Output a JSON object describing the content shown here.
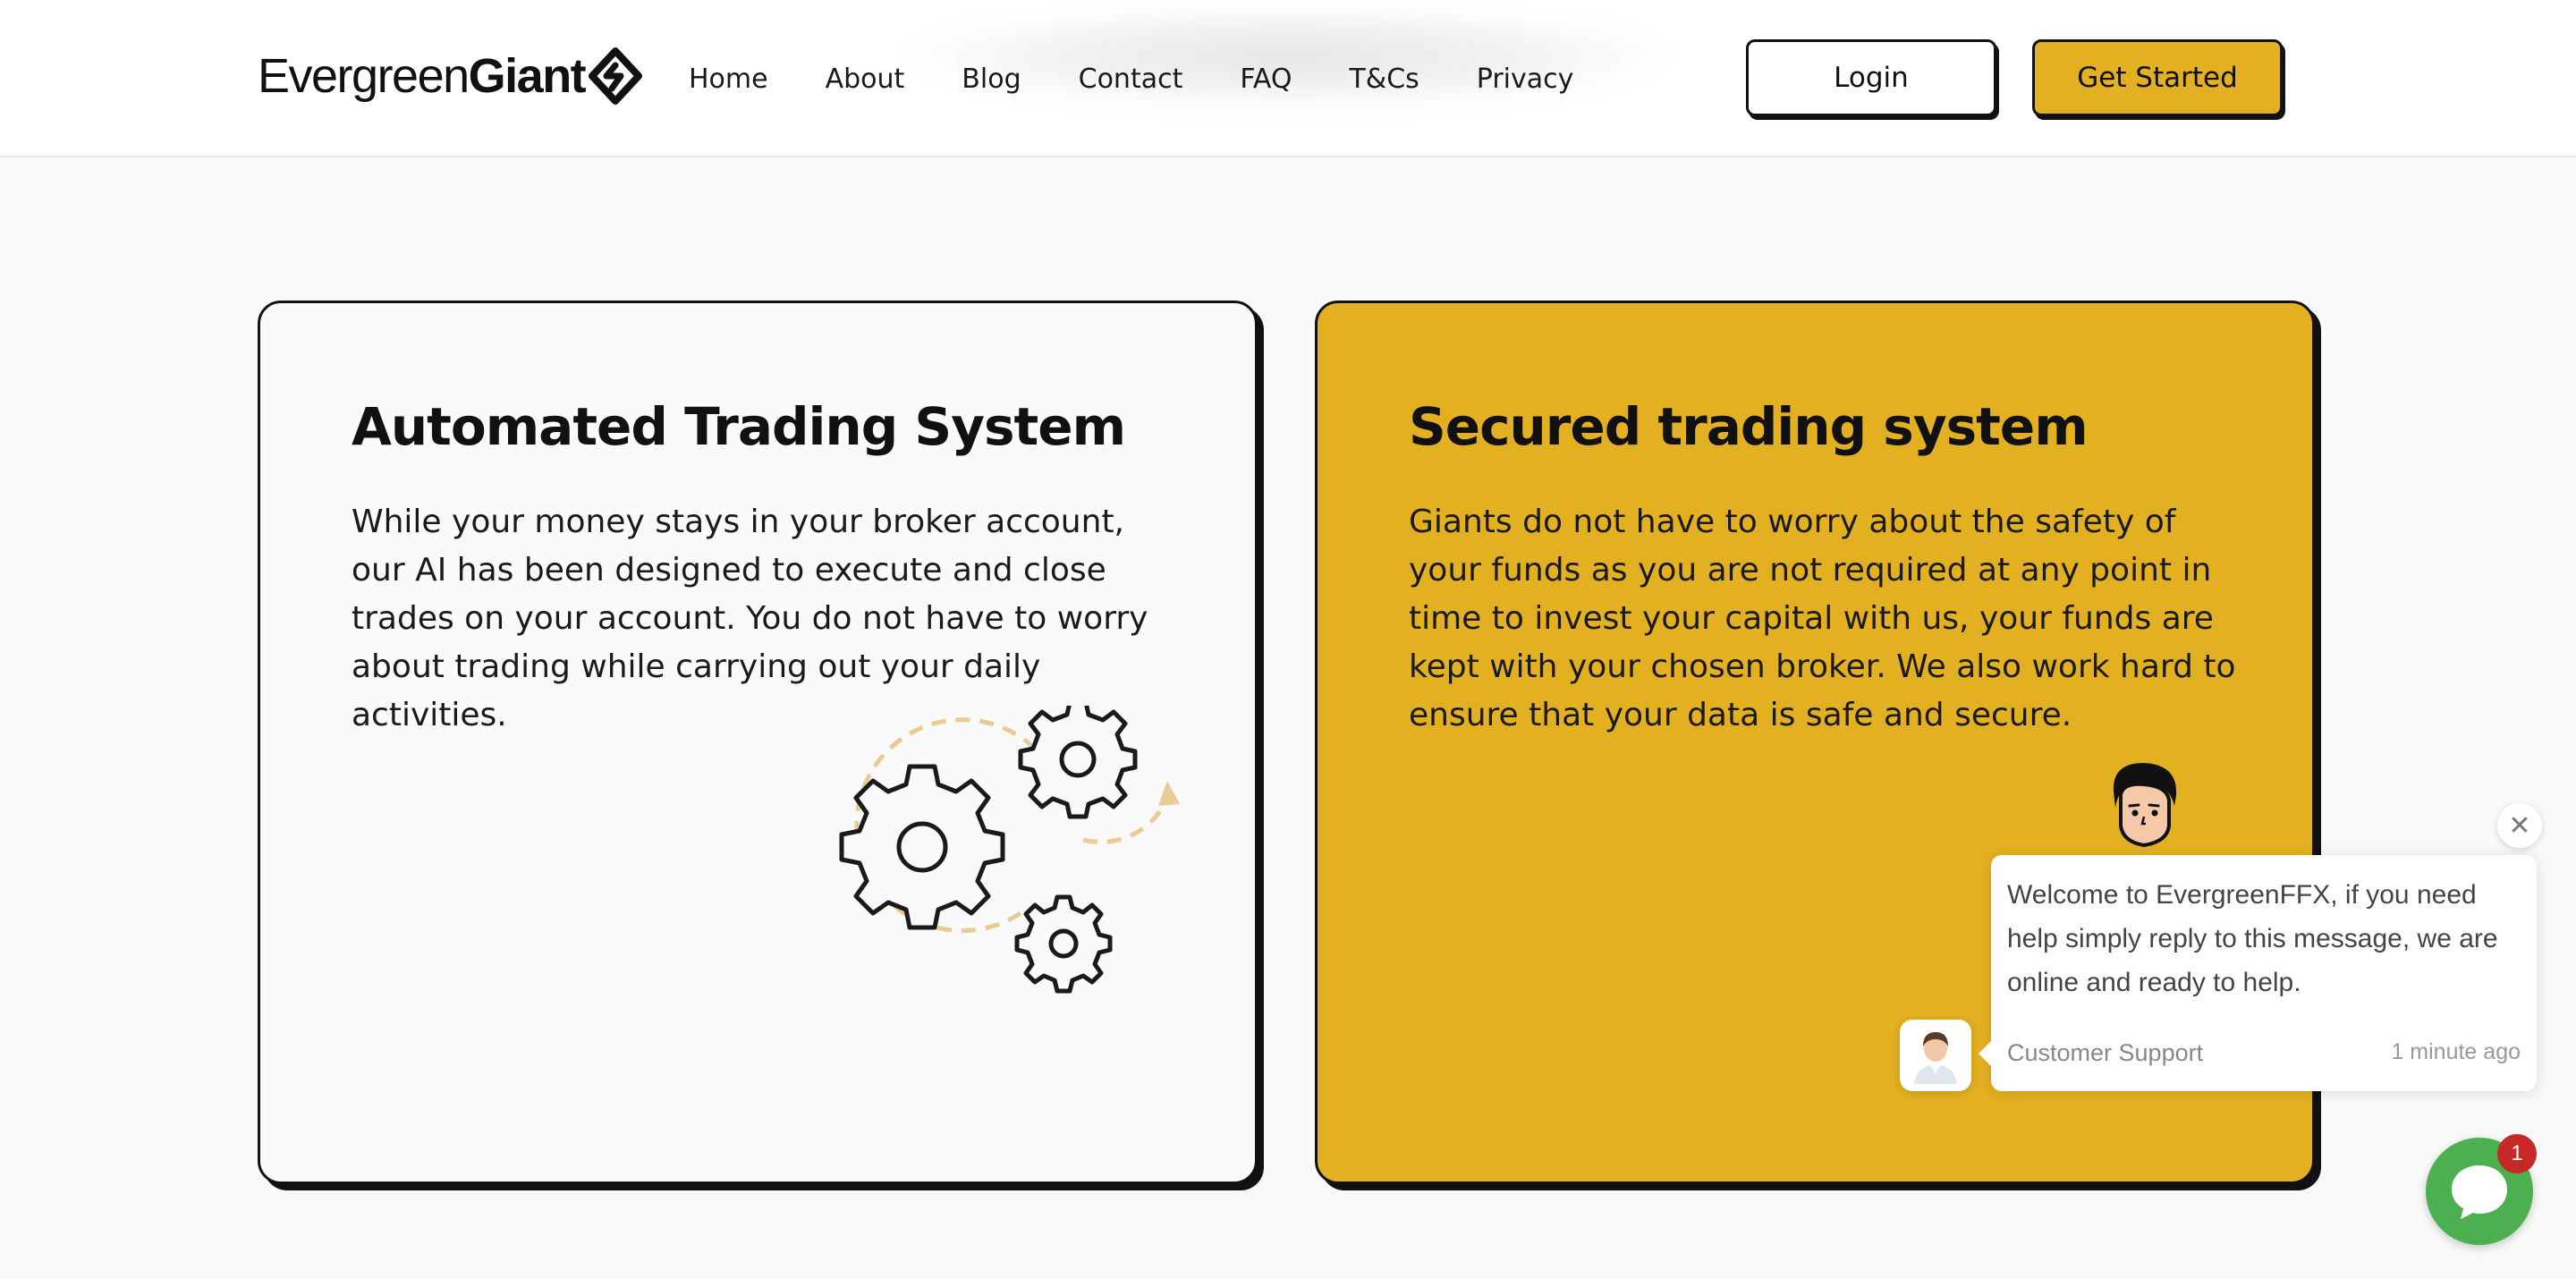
{
  "header": {
    "logo": {
      "text_regular": "Evergreen",
      "text_bold": "Giant"
    },
    "nav": [
      {
        "label": "Home"
      },
      {
        "label": "About"
      },
      {
        "label": "Blog"
      },
      {
        "label": "Contact"
      },
      {
        "label": "FAQ"
      },
      {
        "label": "T&Cs"
      },
      {
        "label": "Privacy"
      }
    ],
    "login_label": "Login",
    "get_started_label": "Get Started"
  },
  "cards": [
    {
      "title": "Automated Trading System",
      "body": "While your money stays in your broker account, our AI has been designed to execute and close trades on your account. You do not have to worry about trading while carrying out your daily activities.",
      "illustration": "gears-icon"
    },
    {
      "title": "Secured trading system",
      "body": "Giants do not have to worry about the safety of your funds as you are not required at any point in time to invest your capital with us, your funds are kept with your chosen broker. We also work hard to ensure that your data is safe and secure.",
      "illustration": "character-icon"
    }
  ],
  "chat": {
    "message": "Welcome to EvergreenFFX, if you need help simply reply to this message, we are online and ready to help.",
    "author": "Customer Support",
    "time": "1 minute ago",
    "badge_count": "1",
    "close_glyph": "✕"
  },
  "colors": {
    "accent": "#e2b021",
    "background": "#f9f9f9",
    "border": "#111111",
    "chat_green": "#4caf50",
    "badge_red": "#c62828"
  }
}
